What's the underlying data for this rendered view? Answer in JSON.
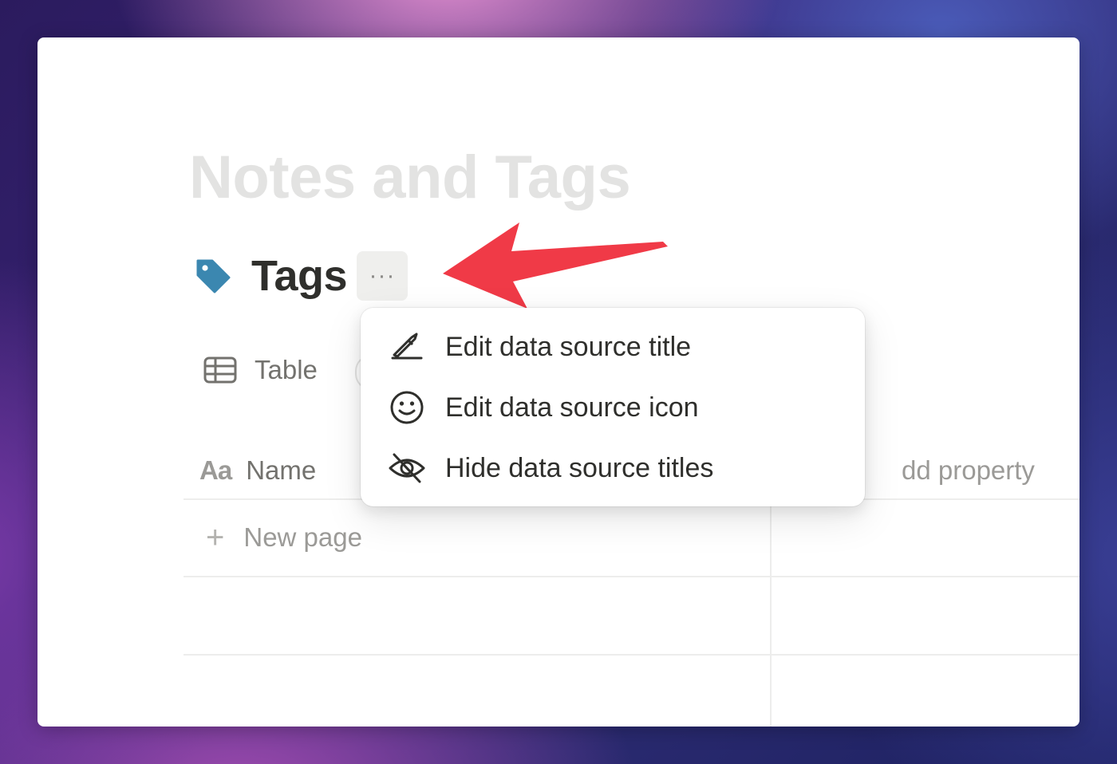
{
  "page": {
    "title": "Notes and Tags"
  },
  "data_source": {
    "title": "Tags",
    "icon": "tag-icon",
    "more_button": "···",
    "icon_color": "#3b87b0"
  },
  "view": {
    "tab_label": "Table",
    "icon": "table-icon"
  },
  "table": {
    "columns": [
      {
        "label": "Name",
        "icon": "text-property-icon",
        "icon_text": "Aa"
      }
    ],
    "add_property_label": "dd property",
    "new_page_label": "New page",
    "new_page_icon": "+"
  },
  "menu": {
    "items": [
      {
        "label": "Edit data source title",
        "icon": "pencil-icon"
      },
      {
        "label": "Edit data source icon",
        "icon": "smiley-icon"
      },
      {
        "label": "Hide data source titles",
        "icon": "eye-slash-icon"
      }
    ]
  },
  "annotation": {
    "arrow_color": "#f03a47"
  }
}
